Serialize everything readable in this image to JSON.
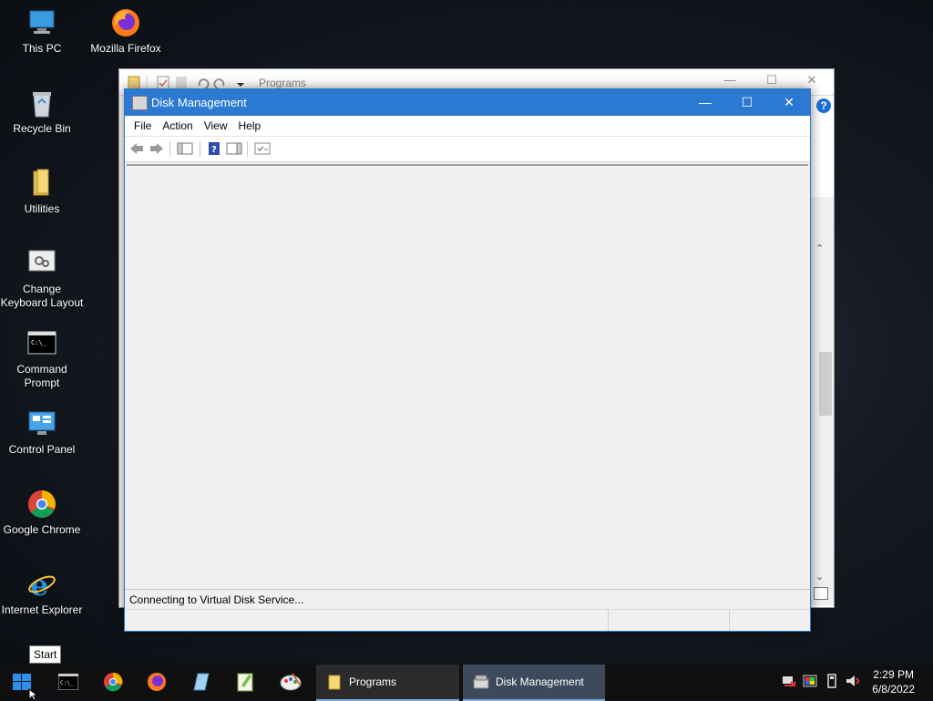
{
  "desktop": {
    "icons": [
      {
        "label": "This PC"
      },
      {
        "label": "Mozilla Firefox"
      },
      {
        "label": "Recycle Bin"
      },
      {
        "label": "Utilities"
      },
      {
        "label": "Change Keyboard Layout"
      },
      {
        "label": "Command Prompt"
      },
      {
        "label": "Control Panel"
      },
      {
        "label": "Google Chrome"
      },
      {
        "label": "Internet Explorer"
      }
    ]
  },
  "background_window": {
    "title": "Programs"
  },
  "disk_management": {
    "title": "Disk Management",
    "menu": {
      "file": "File",
      "action": "Action",
      "view": "View",
      "help": "Help"
    },
    "status": "Connecting to Virtual Disk Service..."
  },
  "tooltip": {
    "text": "Start"
  },
  "taskbar": {
    "tasks": [
      {
        "label": "Programs"
      },
      {
        "label": "Disk Management"
      }
    ],
    "clock": {
      "time": "2:29 PM",
      "date": "6/8/2022"
    }
  },
  "colors": {
    "titlebar": "#2b79d0",
    "taskbar": "#101010",
    "active_task": "#3c4a5c"
  }
}
